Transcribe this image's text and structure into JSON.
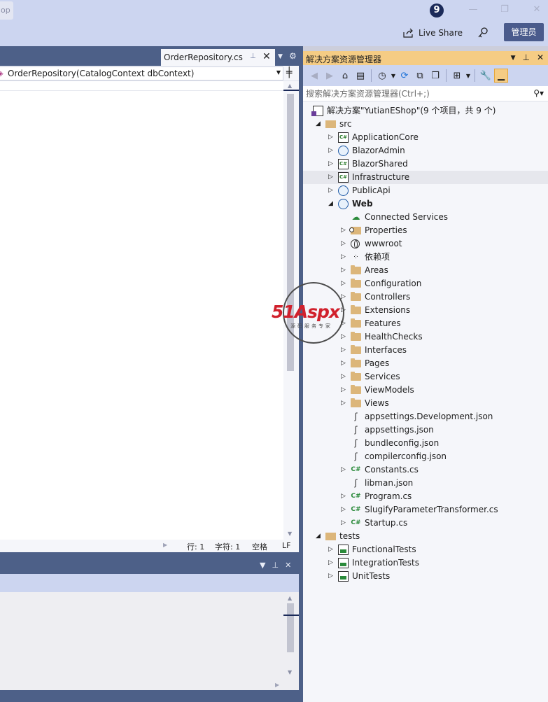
{
  "titlebar": {
    "app_stub": "op",
    "notification_count": "9",
    "live_share_label": "Live Share",
    "admin_label": "管理员"
  },
  "editor": {
    "tab_label": "OrderRepository.cs",
    "nav_member": "OrderRepository(CatalogContext dbContext)",
    "status": {
      "line": "行: 1",
      "char": "字符: 1",
      "whitespace": "空格",
      "eol": "LF"
    }
  },
  "solution_explorer": {
    "title": "解决方案资源管理器",
    "search_placeholder": "搜索解决方案资源管理器(Ctrl+;)",
    "tree": [
      {
        "label": "解决方案\"YutianEShop\"(9 个项目，共 9 个)",
        "icon": "solution-icon",
        "indent": 0,
        "expander": "",
        "bold": false
      },
      {
        "label": "src",
        "icon": "folder-open-icon",
        "indent": 1,
        "expander": "open",
        "bold": false
      },
      {
        "label": "ApplicationCore",
        "icon": "csharp-project-icon",
        "indent": 2,
        "expander": "closed",
        "bold": false
      },
      {
        "label": "BlazorAdmin",
        "icon": "web-project-icon",
        "indent": 2,
        "expander": "closed",
        "bold": false
      },
      {
        "label": "BlazorShared",
        "icon": "csharp-project-icon",
        "indent": 2,
        "expander": "closed",
        "bold": false
      },
      {
        "label": "Infrastructure",
        "icon": "csharp-project-icon",
        "indent": 2,
        "expander": "closed",
        "bold": false,
        "selected": true
      },
      {
        "label": "PublicApi",
        "icon": "web-project-icon",
        "indent": 2,
        "expander": "closed",
        "bold": false
      },
      {
        "label": "Web",
        "icon": "web-project-icon",
        "indent": 2,
        "expander": "open",
        "bold": true
      },
      {
        "label": "Connected Services",
        "icon": "connected-services-icon",
        "indent": 3,
        "expander": "",
        "bold": false
      },
      {
        "label": "Properties",
        "icon": "properties-icon",
        "indent": 3,
        "expander": "closed",
        "bold": false
      },
      {
        "label": "wwwroot",
        "icon": "globe-icon",
        "indent": 3,
        "expander": "closed",
        "bold": false
      },
      {
        "label": "依赖项",
        "icon": "dependencies-icon",
        "indent": 3,
        "expander": "closed",
        "bold": false
      },
      {
        "label": "Areas",
        "icon": "folder-icon",
        "indent": 3,
        "expander": "closed",
        "bold": false
      },
      {
        "label": "Configuration",
        "icon": "folder-icon",
        "indent": 3,
        "expander": "closed",
        "bold": false
      },
      {
        "label": "Controllers",
        "icon": "folder-icon",
        "indent": 3,
        "expander": "closed",
        "bold": false
      },
      {
        "label": "Extensions",
        "icon": "folder-icon",
        "indent": 3,
        "expander": "closed",
        "bold": false
      },
      {
        "label": "Features",
        "icon": "folder-icon",
        "indent": 3,
        "expander": "closed",
        "bold": false
      },
      {
        "label": "HealthChecks",
        "icon": "folder-icon",
        "indent": 3,
        "expander": "closed",
        "bold": false
      },
      {
        "label": "Interfaces",
        "icon": "folder-icon",
        "indent": 3,
        "expander": "closed",
        "bold": false
      },
      {
        "label": "Pages",
        "icon": "folder-icon",
        "indent": 3,
        "expander": "closed",
        "bold": false
      },
      {
        "label": "Services",
        "icon": "folder-icon",
        "indent": 3,
        "expander": "closed",
        "bold": false
      },
      {
        "label": "ViewModels",
        "icon": "folder-icon",
        "indent": 3,
        "expander": "closed",
        "bold": false
      },
      {
        "label": "Views",
        "icon": "folder-icon",
        "indent": 3,
        "expander": "closed",
        "bold": false
      },
      {
        "label": "appsettings.Development.json",
        "icon": "json-file-icon",
        "indent": 3,
        "expander": "",
        "bold": false
      },
      {
        "label": "appsettings.json",
        "icon": "json-file-icon",
        "indent": 3,
        "expander": "",
        "bold": false
      },
      {
        "label": "bundleconfig.json",
        "icon": "json-file-icon",
        "indent": 3,
        "expander": "",
        "bold": false
      },
      {
        "label": "compilerconfig.json",
        "icon": "json-file-icon",
        "indent": 3,
        "expander": "",
        "bold": false
      },
      {
        "label": "Constants.cs",
        "icon": "csharp-file-icon",
        "indent": 3,
        "expander": "closed",
        "bold": false
      },
      {
        "label": "libman.json",
        "icon": "json-file-icon",
        "indent": 3,
        "expander": "",
        "bold": false
      },
      {
        "label": "Program.cs",
        "icon": "csharp-file-icon",
        "indent": 3,
        "expander": "closed",
        "bold": false
      },
      {
        "label": "SlugifyParameterTransformer.cs",
        "icon": "csharp-file-icon",
        "indent": 3,
        "expander": "closed",
        "bold": false
      },
      {
        "label": "Startup.cs",
        "icon": "csharp-file-icon",
        "indent": 3,
        "expander": "closed",
        "bold": false
      },
      {
        "label": "tests",
        "icon": "folder-open-icon",
        "indent": 1,
        "expander": "open",
        "bold": false
      },
      {
        "label": "FunctionalTests",
        "icon": "test-project-icon",
        "indent": 2,
        "expander": "closed",
        "bold": false
      },
      {
        "label": "IntegrationTests",
        "icon": "test-project-icon",
        "indent": 2,
        "expander": "closed",
        "bold": false
      },
      {
        "label": "UnitTests",
        "icon": "test-project-icon",
        "indent": 2,
        "expander": "closed",
        "bold": false
      }
    ]
  },
  "watermark": {
    "logo_text": "51Aspx",
    "logo_sub": "源码服务专家"
  },
  "colors": {
    "title_bg": "#ccd5f0",
    "frame_bg": "#4d6088",
    "panel_header_active": "#f5cc84",
    "accent_dark": "#1b2a59"
  }
}
